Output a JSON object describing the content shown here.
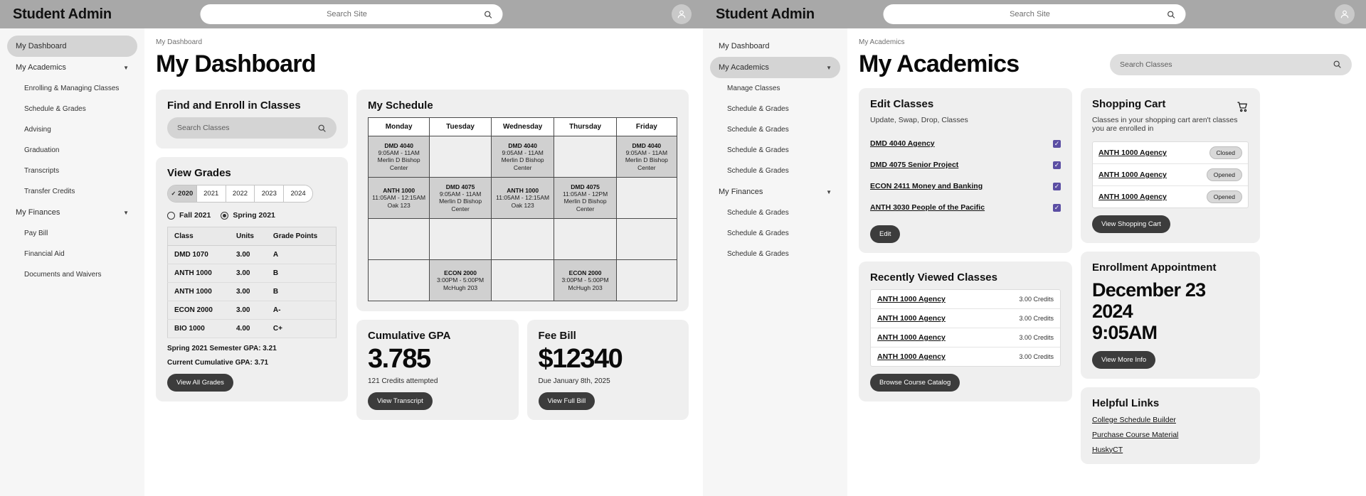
{
  "colors": {
    "topbar": "#a8a8a8",
    "card": "#efefef",
    "checkbox_purple": "#5b4ea3",
    "button_dark": "#3c3c3c"
  },
  "app_left": {
    "brand": "Student Admin",
    "search_placeholder": "Search Site",
    "sidebar": [
      {
        "label": "My Dashboard",
        "level": "top",
        "active": true,
        "caret": false
      },
      {
        "label": "My Academics",
        "level": "top",
        "active": false,
        "caret": true
      },
      {
        "label": "Enrolling & Managing Classes",
        "level": "sub"
      },
      {
        "label": "Schedule & Grades",
        "level": "sub"
      },
      {
        "label": "Advising",
        "level": "sub"
      },
      {
        "label": "Graduation",
        "level": "sub"
      },
      {
        "label": "Transcripts",
        "level": "sub"
      },
      {
        "label": "Transfer Credits",
        "level": "sub"
      },
      {
        "label": "My Finances",
        "level": "top",
        "active": false,
        "caret": true
      },
      {
        "label": "Pay Bill",
        "level": "sub"
      },
      {
        "label": "Financial Aid",
        "level": "sub"
      },
      {
        "label": "Documents and Waivers",
        "level": "sub"
      }
    ],
    "breadcrumb": "My Dashboard",
    "title": "My Dashboard",
    "find_enroll": {
      "title": "Find and Enroll in Classes",
      "search_placeholder": "Search Classes"
    },
    "view_grades": {
      "title": "View Grades",
      "years": [
        "2020",
        "2021",
        "2022",
        "2023",
        "2024"
      ],
      "selected_year": "2020",
      "terms": [
        {
          "label": "Fall 2021",
          "selected": false
        },
        {
          "label": "Spring 2021",
          "selected": true
        }
      ],
      "columns": [
        "Class",
        "Units",
        "Grade Points"
      ],
      "rows": [
        [
          "DMD 1070",
          "3.00",
          "A"
        ],
        [
          "ANTH 1000",
          "3.00",
          "B"
        ],
        [
          "ANTH 1000",
          "3.00",
          "B"
        ],
        [
          "ECON 2000",
          "3.00",
          "A-"
        ],
        [
          "BIO 1000",
          "4.00",
          "C+"
        ]
      ],
      "semester_gpa": "Spring 2021 Semester GPA: 3.21",
      "cumulative_gpa": "Current Cumulative GPA: 3.71",
      "button": "View All Grades"
    },
    "schedule": {
      "title": "My Schedule",
      "days": [
        "Monday",
        "Tuesday",
        "Wednesday",
        "Thursday",
        "Friday"
      ],
      "rows": [
        [
          {
            "code": "DMD 4040",
            "time": "9:05AM - 11AM",
            "loc": "Merlin D Bishop Center"
          },
          null,
          {
            "code": "DMD 4040",
            "time": "9:05AM - 11AM",
            "loc": "Merlin D Bishop Center"
          },
          null,
          {
            "code": "DMD 4040",
            "time": "9:05AM - 11AM",
            "loc": "Merlin D Bishop Center"
          }
        ],
        [
          {
            "code": "ANTH 1000",
            "time": "11:05AM - 12:15AM",
            "loc": "Oak 123"
          },
          {
            "code": "DMD 4075",
            "time": "9:05AM - 11AM",
            "loc": "Merlin D Bishop Center"
          },
          {
            "code": "ANTH 1000",
            "time": "11:05AM - 12:15AM",
            "loc": "Oak 123"
          },
          {
            "code": "DMD 4075",
            "time": "11:05AM - 12PM",
            "loc": "Merlin D Bishop Center"
          },
          null
        ],
        [
          null,
          null,
          null,
          null,
          null
        ],
        [
          null,
          {
            "code": "ECON 2000",
            "time": "3:00PM - 5:00PM",
            "loc": "McHugh 203"
          },
          null,
          {
            "code": "ECON 2000",
            "time": "3:00PM - 5:00PM",
            "loc": "McHugh 203"
          },
          null
        ]
      ]
    },
    "gpa_card": {
      "title": "Cumulative GPA",
      "value": "3.785",
      "note": "121 Credits attempted",
      "button": "View Transcript"
    },
    "fee_card": {
      "title": "Fee Bill",
      "value": "$12340",
      "note": "Due January 8th, 2025",
      "button": "View Full Bill"
    }
  },
  "app_right": {
    "brand": "Student Admin",
    "search_placeholder": "Search Site",
    "sidebar": [
      {
        "label": "My Dashboard",
        "level": "top",
        "active": false,
        "caret": false
      },
      {
        "label": "My Academics",
        "level": "top",
        "active": true,
        "caret": true
      },
      {
        "label": "Manage Classes",
        "level": "sub"
      },
      {
        "label": "Schedule & Grades",
        "level": "sub"
      },
      {
        "label": "Schedule & Grades",
        "level": "sub"
      },
      {
        "label": "Schedule & Grades",
        "level": "sub"
      },
      {
        "label": "Schedule & Grades",
        "level": "sub"
      },
      {
        "label": "My Finances",
        "level": "top",
        "active": false,
        "caret": true
      },
      {
        "label": "Schedule & Grades",
        "level": "sub"
      },
      {
        "label": "Schedule & Grades",
        "level": "sub"
      },
      {
        "label": "Schedule & Grades",
        "level": "sub"
      }
    ],
    "breadcrumb": "My Academics",
    "title": "My Academics",
    "search_classes_placeholder": "Search Classes",
    "edit_classes": {
      "title": "Edit Classes",
      "subtitle": "Update, Swap, Drop, Classes",
      "items": [
        {
          "label": "DMD 4040 Agency",
          "checked": true
        },
        {
          "label": "DMD 4075 Senior Project",
          "checked": true
        },
        {
          "label": "ECON 2411 Money and Banking",
          "checked": true
        },
        {
          "label": "ANTH 3030 People of the Pacific",
          "checked": true
        }
      ],
      "button": "Edit"
    },
    "recently_viewed": {
      "title": "Recently Viewed Classes",
      "items": [
        {
          "label": "ANTH 1000 Agency",
          "credits": "3.00 Credits"
        },
        {
          "label": "ANTH 1000 Agency",
          "credits": "3.00 Credits"
        },
        {
          "label": "ANTH 1000 Agency",
          "credits": "3.00 Credits"
        },
        {
          "label": "ANTH 1000 Agency",
          "credits": "3.00 Credits"
        }
      ],
      "button": "Browse Course Catalog"
    },
    "shopping_cart": {
      "title": "Shopping Cart",
      "subtitle": "Classes in your shopping cart aren't classes you are enrolled in",
      "items": [
        {
          "label": "ANTH 1000 Agency",
          "status": "Closed"
        },
        {
          "label": "ANTH 1000 Agency",
          "status": "Opened"
        },
        {
          "label": "ANTH 1000 Agency",
          "status": "Opened"
        }
      ],
      "button": "View Shopping Cart"
    },
    "enrollment_appointment": {
      "title": "Enrollment Appointment",
      "date_line1": "December 23 2024",
      "date_line2": "9:05AM",
      "button": "View More Info"
    },
    "helpful_links": {
      "title": "Helpful Links",
      "links": [
        "College Schedule Builder",
        "Purchase Course Material",
        "HuskyCT"
      ]
    }
  }
}
